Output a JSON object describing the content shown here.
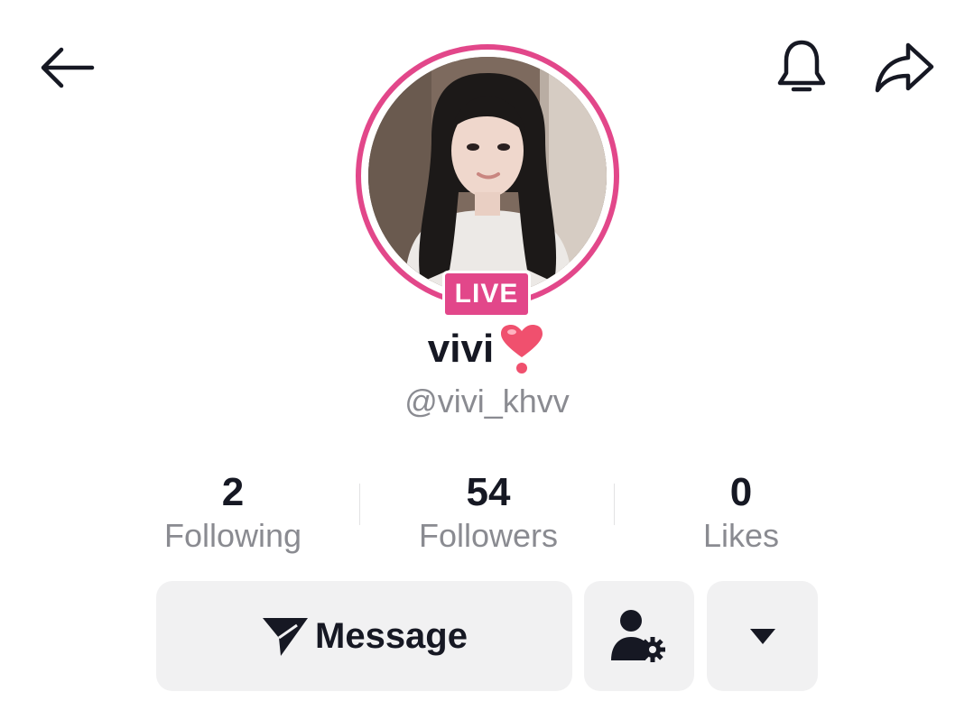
{
  "header": {
    "back_icon": "arrow-left-icon",
    "bell_icon": "bell-icon",
    "share_icon": "share-arrow-icon"
  },
  "profile": {
    "live_badge": "LIVE",
    "display_name": "vivi",
    "name_emoji": "heart-exclamation-emoji",
    "username": "@vivi_khvv",
    "accent_color": "#e2478a"
  },
  "stats": [
    {
      "value": "2",
      "label": "Following"
    },
    {
      "value": "54",
      "label": "Followers"
    },
    {
      "value": "0",
      "label": "Likes"
    }
  ],
  "actions": {
    "message_label": "Message",
    "message_icon": "paper-plane-icon",
    "friend_settings_icon": "user-gear-icon",
    "more_icon": "caret-down-icon"
  }
}
